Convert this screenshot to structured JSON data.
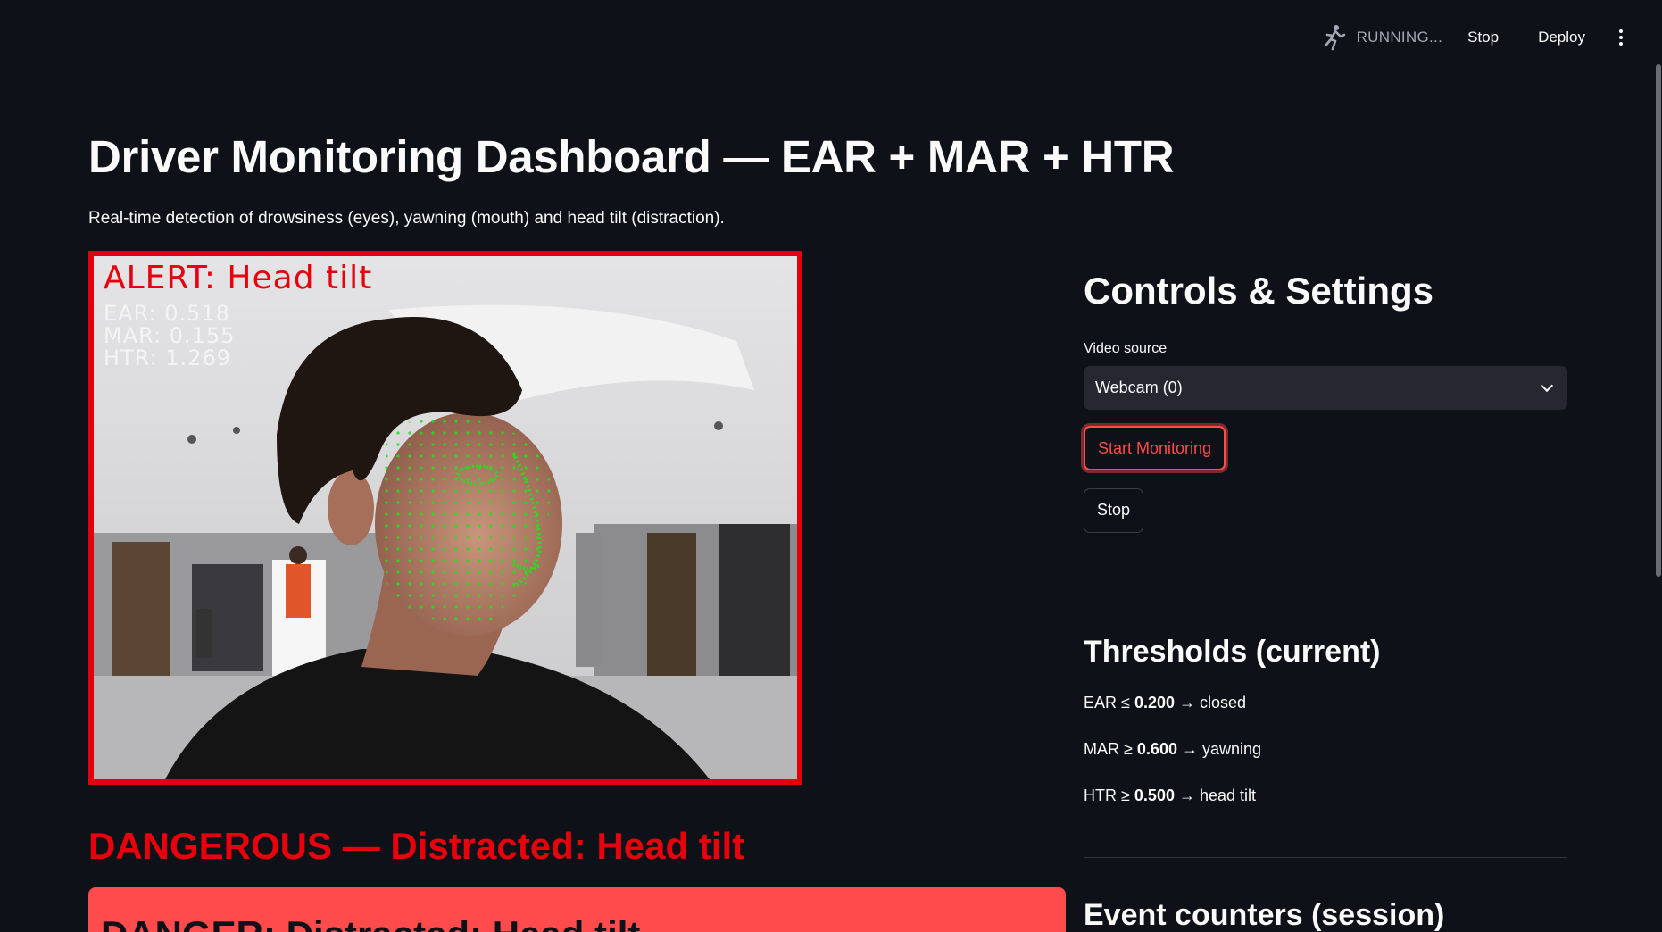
{
  "toolbar": {
    "running_label": "RUNNING...",
    "stop_label": "Stop",
    "deploy_label": "Deploy"
  },
  "page": {
    "title": "Driver Monitoring Dashboard — EAR + MAR + HTR",
    "subtitle": "Real-time detection of drowsiness (eyes), yawning (mouth) and head tilt (distraction)."
  },
  "video_overlay": {
    "alert": "ALERT: Head tilt",
    "ear": "EAR: 0.518",
    "mar": "MAR: 0.155",
    "htr": "HTR: 1.269"
  },
  "status": {
    "heading": "DANGEROUS — Distracted: Head tilt",
    "box_text": "DANGER: Distracted: Head tilt"
  },
  "controls": {
    "heading": "Controls & Settings",
    "video_source_label": "Video source",
    "video_source_value": "Webcam (0)",
    "start_label": "Start Monitoring",
    "stop_label": "Stop"
  },
  "thresholds": {
    "heading": "Thresholds (current)",
    "rows": [
      {
        "metric": "EAR",
        "op": "≤",
        "value": "0.200",
        "arrow": "→",
        "meaning": "closed"
      },
      {
        "metric": "MAR",
        "op": "≥",
        "value": "0.600",
        "arrow": "→",
        "meaning": "yawning"
      },
      {
        "metric": "HTR",
        "op": "≥",
        "value": "0.500",
        "arrow": "→",
        "meaning": "head tilt"
      }
    ]
  },
  "counters": {
    "heading": "Event counters (session)"
  },
  "colors": {
    "background": "#0e1117",
    "alert_red": "#e8000c",
    "danger_box": "#ff4b4b",
    "input_bg": "#262730",
    "landmark_green": "#22e01a"
  }
}
